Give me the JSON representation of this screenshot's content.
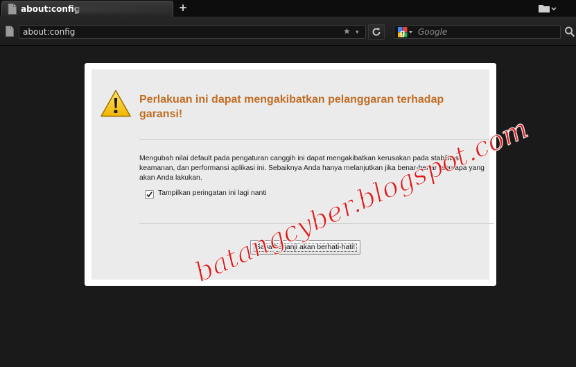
{
  "tabs": [
    {
      "title": "about:config",
      "active": true
    }
  ],
  "tabstrip": {
    "new_tab_label": "+"
  },
  "navbar": {
    "url": "about:config",
    "bookmark_star": "★",
    "dropmarker": "▾",
    "search": {
      "placeholder": "Google",
      "engine_icon": "google-icon"
    }
  },
  "warning": {
    "icon": "warning-triangle-icon",
    "title": "Perlakuan ini dapat mengakibatkan pelanggaran terhadap garansi!",
    "body": "Mengubah nilai default pada pengaturan canggih ini dapat mengakibatkan kerusakan pada stabilitas, keamanan, dan performansi aplikasi ini. Sebaiknya Anda hanya melanjutkan jika benar-benar tahu apa yang akan Anda lakukan.",
    "checkbox_label": "Tampilkan peringatan ini lagi nanti",
    "checkbox_checked": true,
    "button_label": "Saya berjanji akan berhati-hati!"
  },
  "watermark": "batangcyber.blogspot.com",
  "colors": {
    "chrome_bg": "#1a1a1a",
    "title_orange": "#c06d24",
    "watermark_red": "#e01a1a"
  }
}
